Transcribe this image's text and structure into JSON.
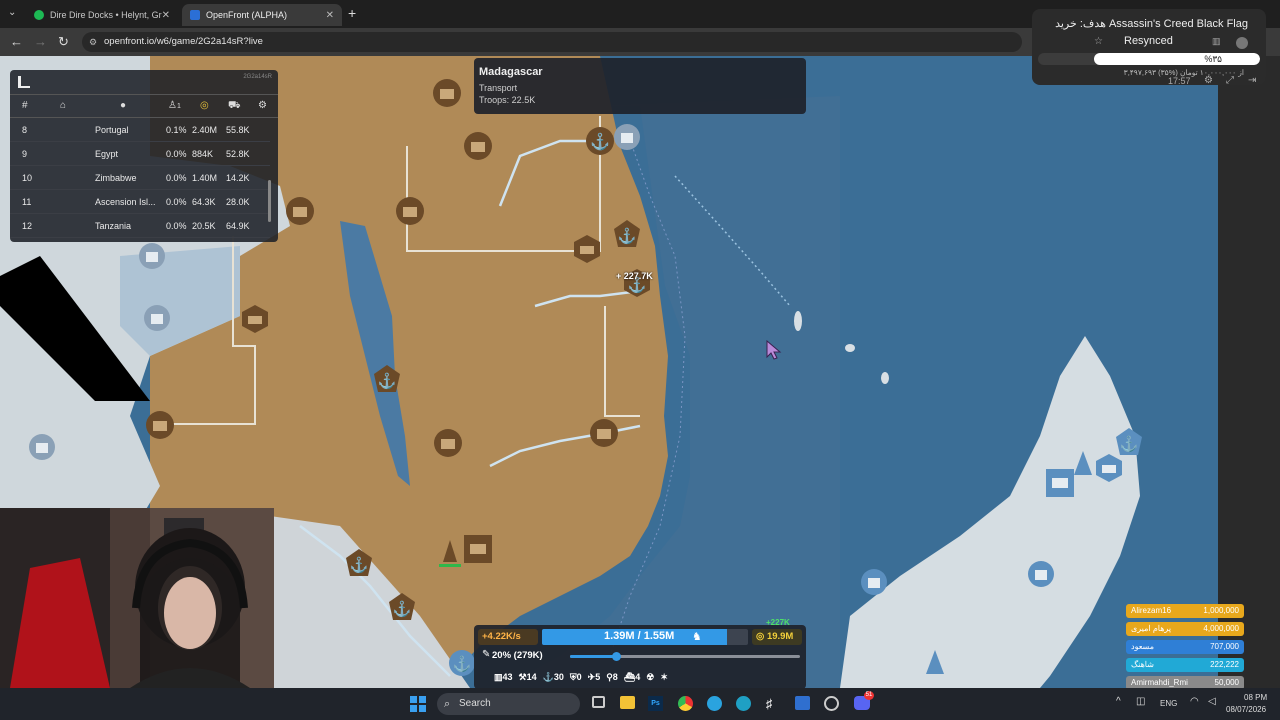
{
  "browser": {
    "tabs": [
      {
        "label": "Dire Dire Docks • Helynt, Gr",
        "active": false
      },
      {
        "label": "OpenFront (ALPHA)",
        "active": true
      }
    ],
    "new_tab": "+",
    "url": "openfront.io/w6/game/2G2a14sR?live"
  },
  "leaderboard": {
    "game_id": "2G2a14sR",
    "headers": {
      "rank": "#",
      "player_icon": "1"
    },
    "rows": [
      {
        "rank": "8",
        "name": "Portugal",
        "pct": "0.1%",
        "gold": "2.40M",
        "troops": "55.8K"
      },
      {
        "rank": "9",
        "name": "Egypt",
        "pct": "0.0%",
        "gold": "884K",
        "troops": "52.8K"
      },
      {
        "rank": "10",
        "name": "Zimbabwe",
        "pct": "0.0%",
        "gold": "1.40M",
        "troops": "14.2K"
      },
      {
        "rank": "11",
        "name": "Ascension Isl...",
        "pct": "0.0%",
        "gold": "64.3K",
        "troops": "28.0K"
      },
      {
        "rank": "12",
        "name": "Tanzania",
        "pct": "0.0%",
        "gold": "20.5K",
        "troops": "64.9K"
      }
    ]
  },
  "tooltip": {
    "title": "Madagascar",
    "line1": "Transport",
    "line2": "Troops: 22.5K"
  },
  "map": {
    "attack_label": "+ 227.7K",
    "pending_label": "+227K"
  },
  "notification": {
    "title": "هدف: خرید Assassin's Creed Black Flag",
    "status": "Resynced",
    "percent": "%۳۵",
    "subtitle": "۳,۴۹۷,۶۹۳ از ۱۰,۰۰۰,۰۰۰ تومان (%۳۵)",
    "time": "17:57",
    "progress_fraction": 0.35
  },
  "hud": {
    "income": "+4.22K/s",
    "troops": "1.39M / 1.55M",
    "gold": "19.9M",
    "attack_ratio": "20% (279K)",
    "attack_ratio_fraction": 0.2,
    "troop_fill_fraction": 0.9,
    "buildings": [
      {
        "icon": "city-icon",
        "count": "43"
      },
      {
        "icon": "factory-icon",
        "count": "14"
      },
      {
        "icon": "port-icon",
        "count": "30"
      },
      {
        "icon": "defense-icon",
        "count": "0"
      },
      {
        "icon": "missile-icon",
        "count": "5"
      },
      {
        "icon": "sam-icon",
        "count": "8"
      },
      {
        "icon": "warship-icon",
        "count": "4"
      },
      {
        "icon": "nuke-icon",
        "count": ""
      },
      {
        "icon": "mirv-icon",
        "count": ""
      }
    ]
  },
  "players": [
    {
      "name": "Alirezam16",
      "value": "1,000,000",
      "color": "#e8a81c"
    },
    {
      "name": "پرهام امیری",
      "value": "4,000,000",
      "color": "#e8a81c"
    },
    {
      "name": "مسعود",
      "value": "707,000",
      "color": "#2f7fd6"
    },
    {
      "name": "شاهنگ",
      "value": "222,222",
      "color": "#21a9d6"
    },
    {
      "name": "Amirmahdi_Rmi",
      "value": "50,000",
      "color": "#8a8a8a"
    },
    {
      "name": "farid.h.b",
      "value": "50,000",
      "color": "#7b7f8a"
    }
  ],
  "taskbar": {
    "search": "Search",
    "lang": "ENG",
    "time": "08 PM",
    "date": "08/07/2026",
    "discord_badge": "51"
  }
}
